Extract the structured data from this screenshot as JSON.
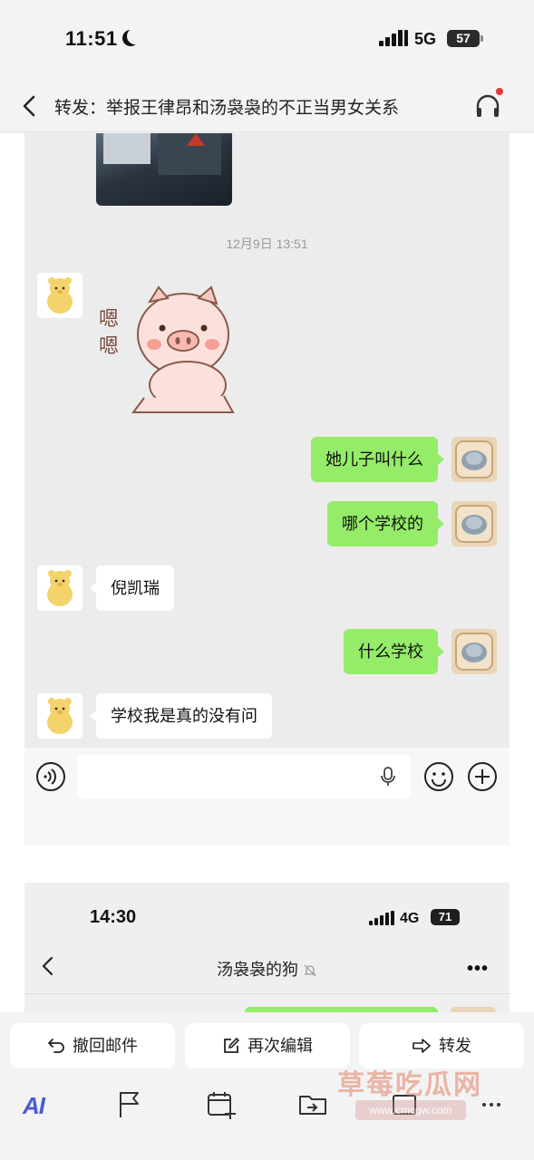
{
  "status_bar": {
    "time": "11:51",
    "network": "5G",
    "battery": "57"
  },
  "header": {
    "title": "转发：举报王律昂和汤袅袅的不正当男女关系"
  },
  "chat": {
    "timestamp": "12月9日 13:51",
    "messages": [
      {
        "from": "me",
        "text": "她儿子叫什么"
      },
      {
        "from": "me",
        "text": "哪个学校的"
      },
      {
        "from": "other",
        "text": "倪凯瑞"
      },
      {
        "from": "me",
        "text": "什么学校"
      },
      {
        "from": "other",
        "text": "学校我是真的没有问"
      }
    ],
    "sticker_text": "嗯嗯"
  },
  "screenshot2": {
    "time": "14:30",
    "network": "4G",
    "battery": "71",
    "title": "汤袅袅的狗",
    "more": "•••"
  },
  "actions": {
    "recall": "撤回邮件",
    "edit": "再次编辑",
    "forward": "转发"
  },
  "toolbar": {
    "ai": "AI"
  },
  "watermark": {
    "text": "草莓吃瓜网",
    "url": "www.cmcgw.com"
  },
  "colors": {
    "my_bubble": "#95ec69",
    "ai_accent": "#4a5bd8",
    "notification": "#e53935"
  }
}
